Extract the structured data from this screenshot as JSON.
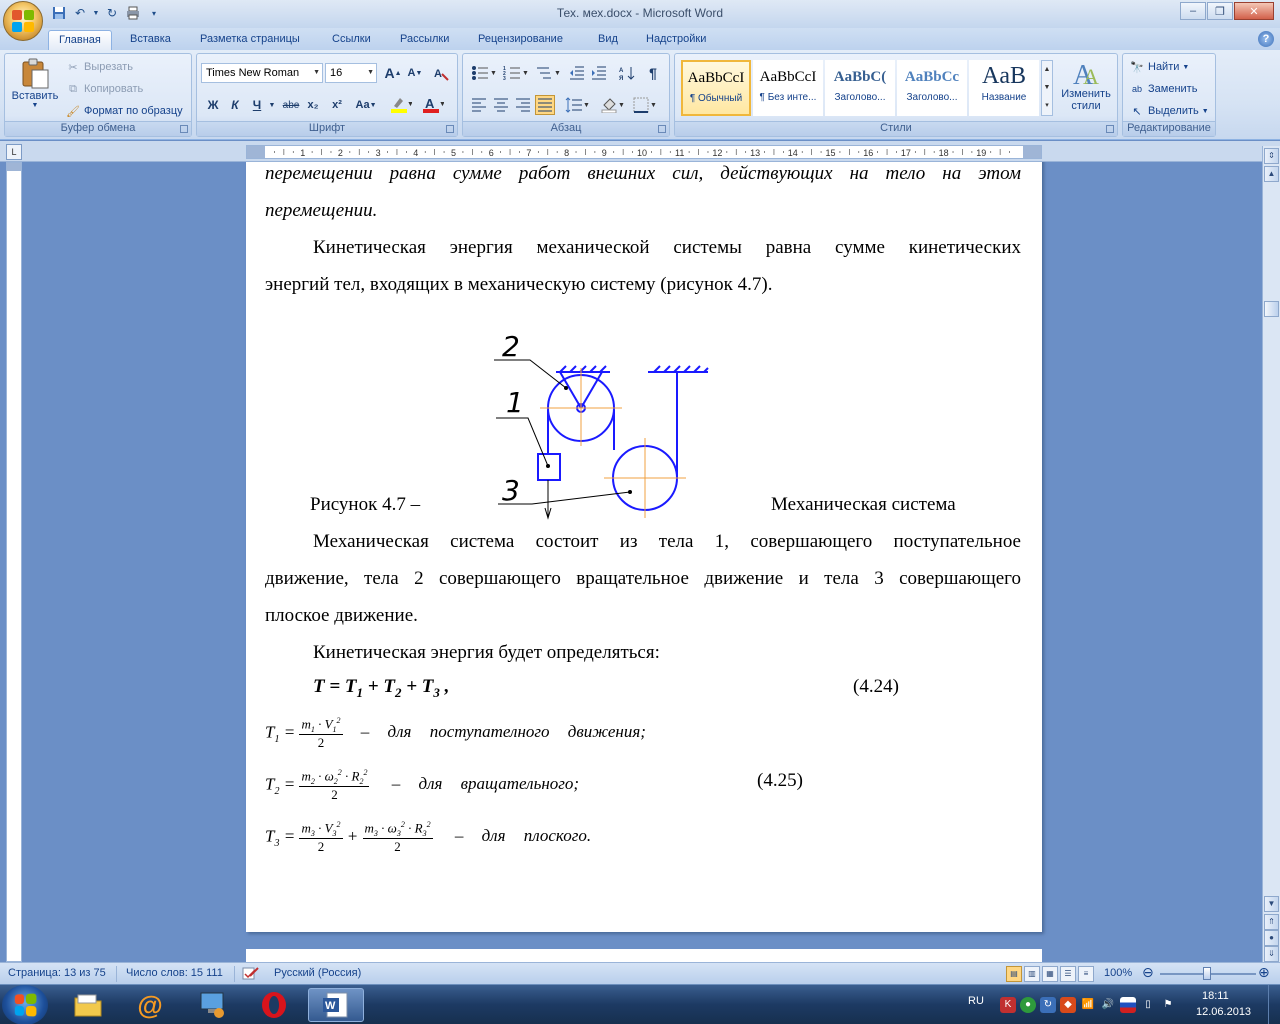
{
  "window": {
    "title": "Тех. мех.docx - Microsoft Word"
  },
  "tabs": [
    "Главная",
    "Вставка",
    "Разметка страницы",
    "Ссылки",
    "Рассылки",
    "Рецензирование",
    "Вид",
    "Надстройки"
  ],
  "ribbon": {
    "clipboard": {
      "label": "Буфер обмена",
      "paste": "Вставить",
      "cut": "Вырезать",
      "copy": "Копировать",
      "format_painter": "Формат по образцу"
    },
    "font": {
      "label": "Шрифт",
      "family": "Times New Roman",
      "size": "16",
      "bold": "Ж",
      "italic": "К",
      "underline": "Ч",
      "strike": "abe",
      "subscript": "x₂",
      "superscript": "x²",
      "case": "Aa",
      "grow": "A",
      "shrink": "A"
    },
    "paragraph": {
      "label": "Абзац"
    },
    "styles": {
      "label": "Стили",
      "items": [
        {
          "sample": "AaBbCcI",
          "name": "¶ Обычный"
        },
        {
          "sample": "AaBbCcI",
          "name": "¶ Без инте..."
        },
        {
          "sample": "AaBbC(",
          "name": "Заголово..."
        },
        {
          "sample": "AaBbCc",
          "name": "Заголово..."
        },
        {
          "sample": "AaB",
          "name": "Название"
        }
      ],
      "change_styles": "Изменить стили"
    },
    "editing": {
      "label": "Редактирование",
      "find": "Найти",
      "replace": "Заменить",
      "select": "Выделить"
    }
  },
  "ruler": {
    "numbers": [
      "1",
      "2",
      "3",
      "4",
      "5",
      "6",
      "7",
      "8",
      "9",
      "10",
      "11",
      "12",
      "13",
      "14",
      "15",
      "16",
      "17",
      "18",
      "19"
    ],
    "tab_selector": "L"
  },
  "document": {
    "p1_line1": "перемещении равна сумме работ внешних сил, действующих на тело на этом",
    "p1_line2": "перемещении.",
    "p2_line1": "Кинетическая энергия механической системы равна сумме кинетических",
    "p2_line2": "энергий тел, входящих в механическую систему (рисунок 4.7).",
    "figure_labels": {
      "l1": "1",
      "l2": "2",
      "l3": "3"
    },
    "caption_left": "Рисунок 4.7 –",
    "caption_right": "Механическая система",
    "p3_line1": "Механическая система состоит из тела 1, совершающего поступательное",
    "p3_line2": "движение, тела 2 совершающего вращательное движение и тела 3 совершающего",
    "p3_line3": "плоское движение.",
    "p4": "Кинетическая энергия будет определяться:",
    "eq424_num": "(4.24)",
    "eq425_num": "(4.25)",
    "f1_text": "– для поступателного движения;",
    "f2_text": "– для вращательного;",
    "f3_text": "– для плоского."
  },
  "status": {
    "page": "Страница: 13 из 75",
    "words": "Число слов: 15 111",
    "lang": "Русский (Россия)",
    "zoom": "100%"
  },
  "taskbar": {
    "lang": "RU",
    "time": "18:11",
    "date": "12.06.2013"
  }
}
